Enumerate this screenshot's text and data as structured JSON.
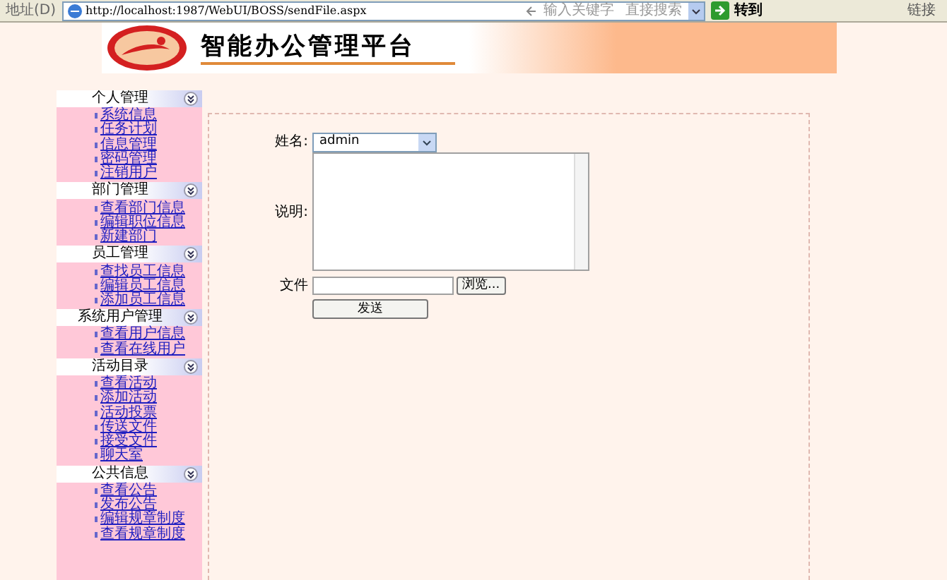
{
  "address_bar": {
    "label": "地址(D)",
    "url": "http://localhost:1987/WebUI/BOSS/sendFile.aspx",
    "search_placeholder": "输入关键字",
    "search_button": "直接搜索",
    "go": "转到",
    "links": "链接"
  },
  "banner": {
    "title": "智能办公管理平台"
  },
  "sidebar": [
    {
      "title": "个人管理",
      "expanded": true,
      "items": [
        "系统信息",
        "任务计划",
        "信息管理",
        "密码管理",
        "注销用户"
      ]
    },
    {
      "title": "部门管理",
      "expanded": true,
      "items": [
        "查看部门信息",
        "编辑职位信息",
        "新建部门"
      ]
    },
    {
      "title": "员工管理",
      "expanded": true,
      "items": [
        "查找员工信息",
        "编辑员工信息",
        "添加员工信息"
      ]
    },
    {
      "title": "系统用户管理",
      "expanded": true,
      "items": [
        "查看用户信息",
        "查看在线用户"
      ]
    },
    {
      "title": "活动目录",
      "expanded": true,
      "items": [
        "查看活动",
        "添加活动",
        "活动投票",
        "传送文件",
        "接受文件",
        "聊天室"
      ]
    },
    {
      "title": "公共信息",
      "expanded": true,
      "items": [
        "查看公告",
        "发布公告",
        "编辑规章制度",
        "查看规章制度"
      ]
    }
  ],
  "form": {
    "name_label": "姓名:",
    "name_value": "admin",
    "description_label": "说明:",
    "file_label": "文件",
    "browse": "浏览...",
    "send": "发送"
  }
}
